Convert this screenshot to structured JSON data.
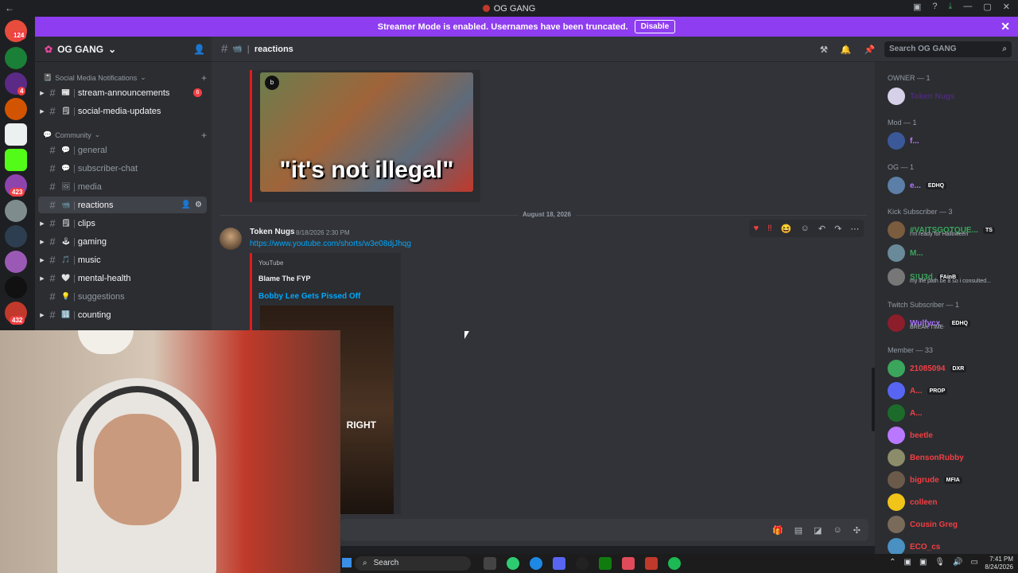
{
  "window": {
    "title": "OG GANG"
  },
  "banner": {
    "text": "Streamer Mode is enabled. Usernames have been truncated.",
    "button": "Disable"
  },
  "servers": {
    "badges": [
      "124",
      "4",
      "423",
      "432"
    ]
  },
  "sidebar": {
    "server_name": "OG GANG",
    "categories": [
      {
        "label": "Social Media Notifications"
      },
      {
        "label": "Community"
      }
    ],
    "channels": [
      {
        "label": "stream-announcements",
        "emoji": "📰",
        "count": "6",
        "unread": true,
        "arrow": true
      },
      {
        "label": "social-media-updates",
        "emoji": "🗒",
        "unread": true,
        "arrow": true
      },
      {
        "label": "general",
        "emoji": "💬",
        "unread": false
      },
      {
        "label": "subscriber-chat",
        "emoji": "💬",
        "unread": false
      },
      {
        "label": "media",
        "emoji": "🖼",
        "unread": false
      },
      {
        "label": "reactions",
        "emoji": "📹",
        "active": true
      },
      {
        "label": "clips",
        "emoji": "🗒",
        "unread": true,
        "arrow": true
      },
      {
        "label": "gaming",
        "emoji": "🕹",
        "unread": true,
        "arrow": true
      },
      {
        "label": "music",
        "emoji": "🎵",
        "unread": true,
        "arrow": true
      },
      {
        "label": "mental-health",
        "emoji": "🤍",
        "unread": true,
        "arrow": true
      },
      {
        "label": "suggestions",
        "emoji": "💡",
        "unread": false
      },
      {
        "label": "counting",
        "emoji": "🔢",
        "unread": true,
        "arrow": true
      }
    ]
  },
  "chat": {
    "channel": "reactions",
    "search_placeholder": "Search OG GANG",
    "first_caption": "\"it's not illegal\"",
    "date_divider": "August 18, 2026",
    "message": {
      "author": "Token Nugs",
      "timestamp": "8/18/2026 2:30 PM",
      "link": "https://www.youtube.com/shorts/w3e08djJhqg",
      "embed_provider": "YouTube",
      "embed_author": "Blame The FYP",
      "embed_title": "Bobby Lee Gets Pissed Off",
      "video_caption": "RIGHT"
    }
  },
  "members": {
    "roles": [
      {
        "title": "OWNER — 1"
      },
      {
        "title": "Mod — 1"
      },
      {
        "title": "OG — 1"
      },
      {
        "title": "Kick Subscriber — 3"
      },
      {
        "title": "Twitch Subscriber — 1"
      },
      {
        "title": "Member — 33"
      }
    ],
    "list": [
      {
        "name": "Token Nugs",
        "color": "#6b3fa0"
      },
      {
        "name": "f...",
        "color": "#b978ff"
      },
      {
        "name": "e...",
        "color": "#b978ff",
        "tag": "EDHQ"
      },
      {
        "name": "#VAITSGOTQUE...",
        "color": "#3ba55c",
        "tag": "TS",
        "sub": "I'm ready for Halloween"
      },
      {
        "name": "M...",
        "color": "#3ba55c"
      },
      {
        "name": "S!U3d",
        "color": "#3ba55c",
        "tag": "FAinB",
        "sub": "my life path be 8 so i consulted..."
      },
      {
        "name": "Wulfycx_",
        "color": "#a970ff",
        "tag": "EDHQ",
        "sub": "BREAK TIME"
      },
      {
        "name": "21085094",
        "color": "#f23f43",
        "tag": "DXR"
      },
      {
        "name": "A...",
        "color": "#f23f43",
        "tag": "PROP"
      },
      {
        "name": "A...",
        "color": "#f23f43"
      },
      {
        "name": "beetle",
        "color": "#f23f43"
      },
      {
        "name": "BensonRubby",
        "color": "#f23f43"
      },
      {
        "name": "bigrude",
        "color": "#f23f43",
        "tag": "MFIA"
      },
      {
        "name": "colleen",
        "color": "#f23f43"
      },
      {
        "name": "Cousin Greg",
        "color": "#f23f43"
      },
      {
        "name": "ECO_cs",
        "color": "#f23f43"
      }
    ]
  },
  "taskbar": {
    "search": "Search",
    "time": "7:41 PM",
    "date": "8/24/2026"
  }
}
